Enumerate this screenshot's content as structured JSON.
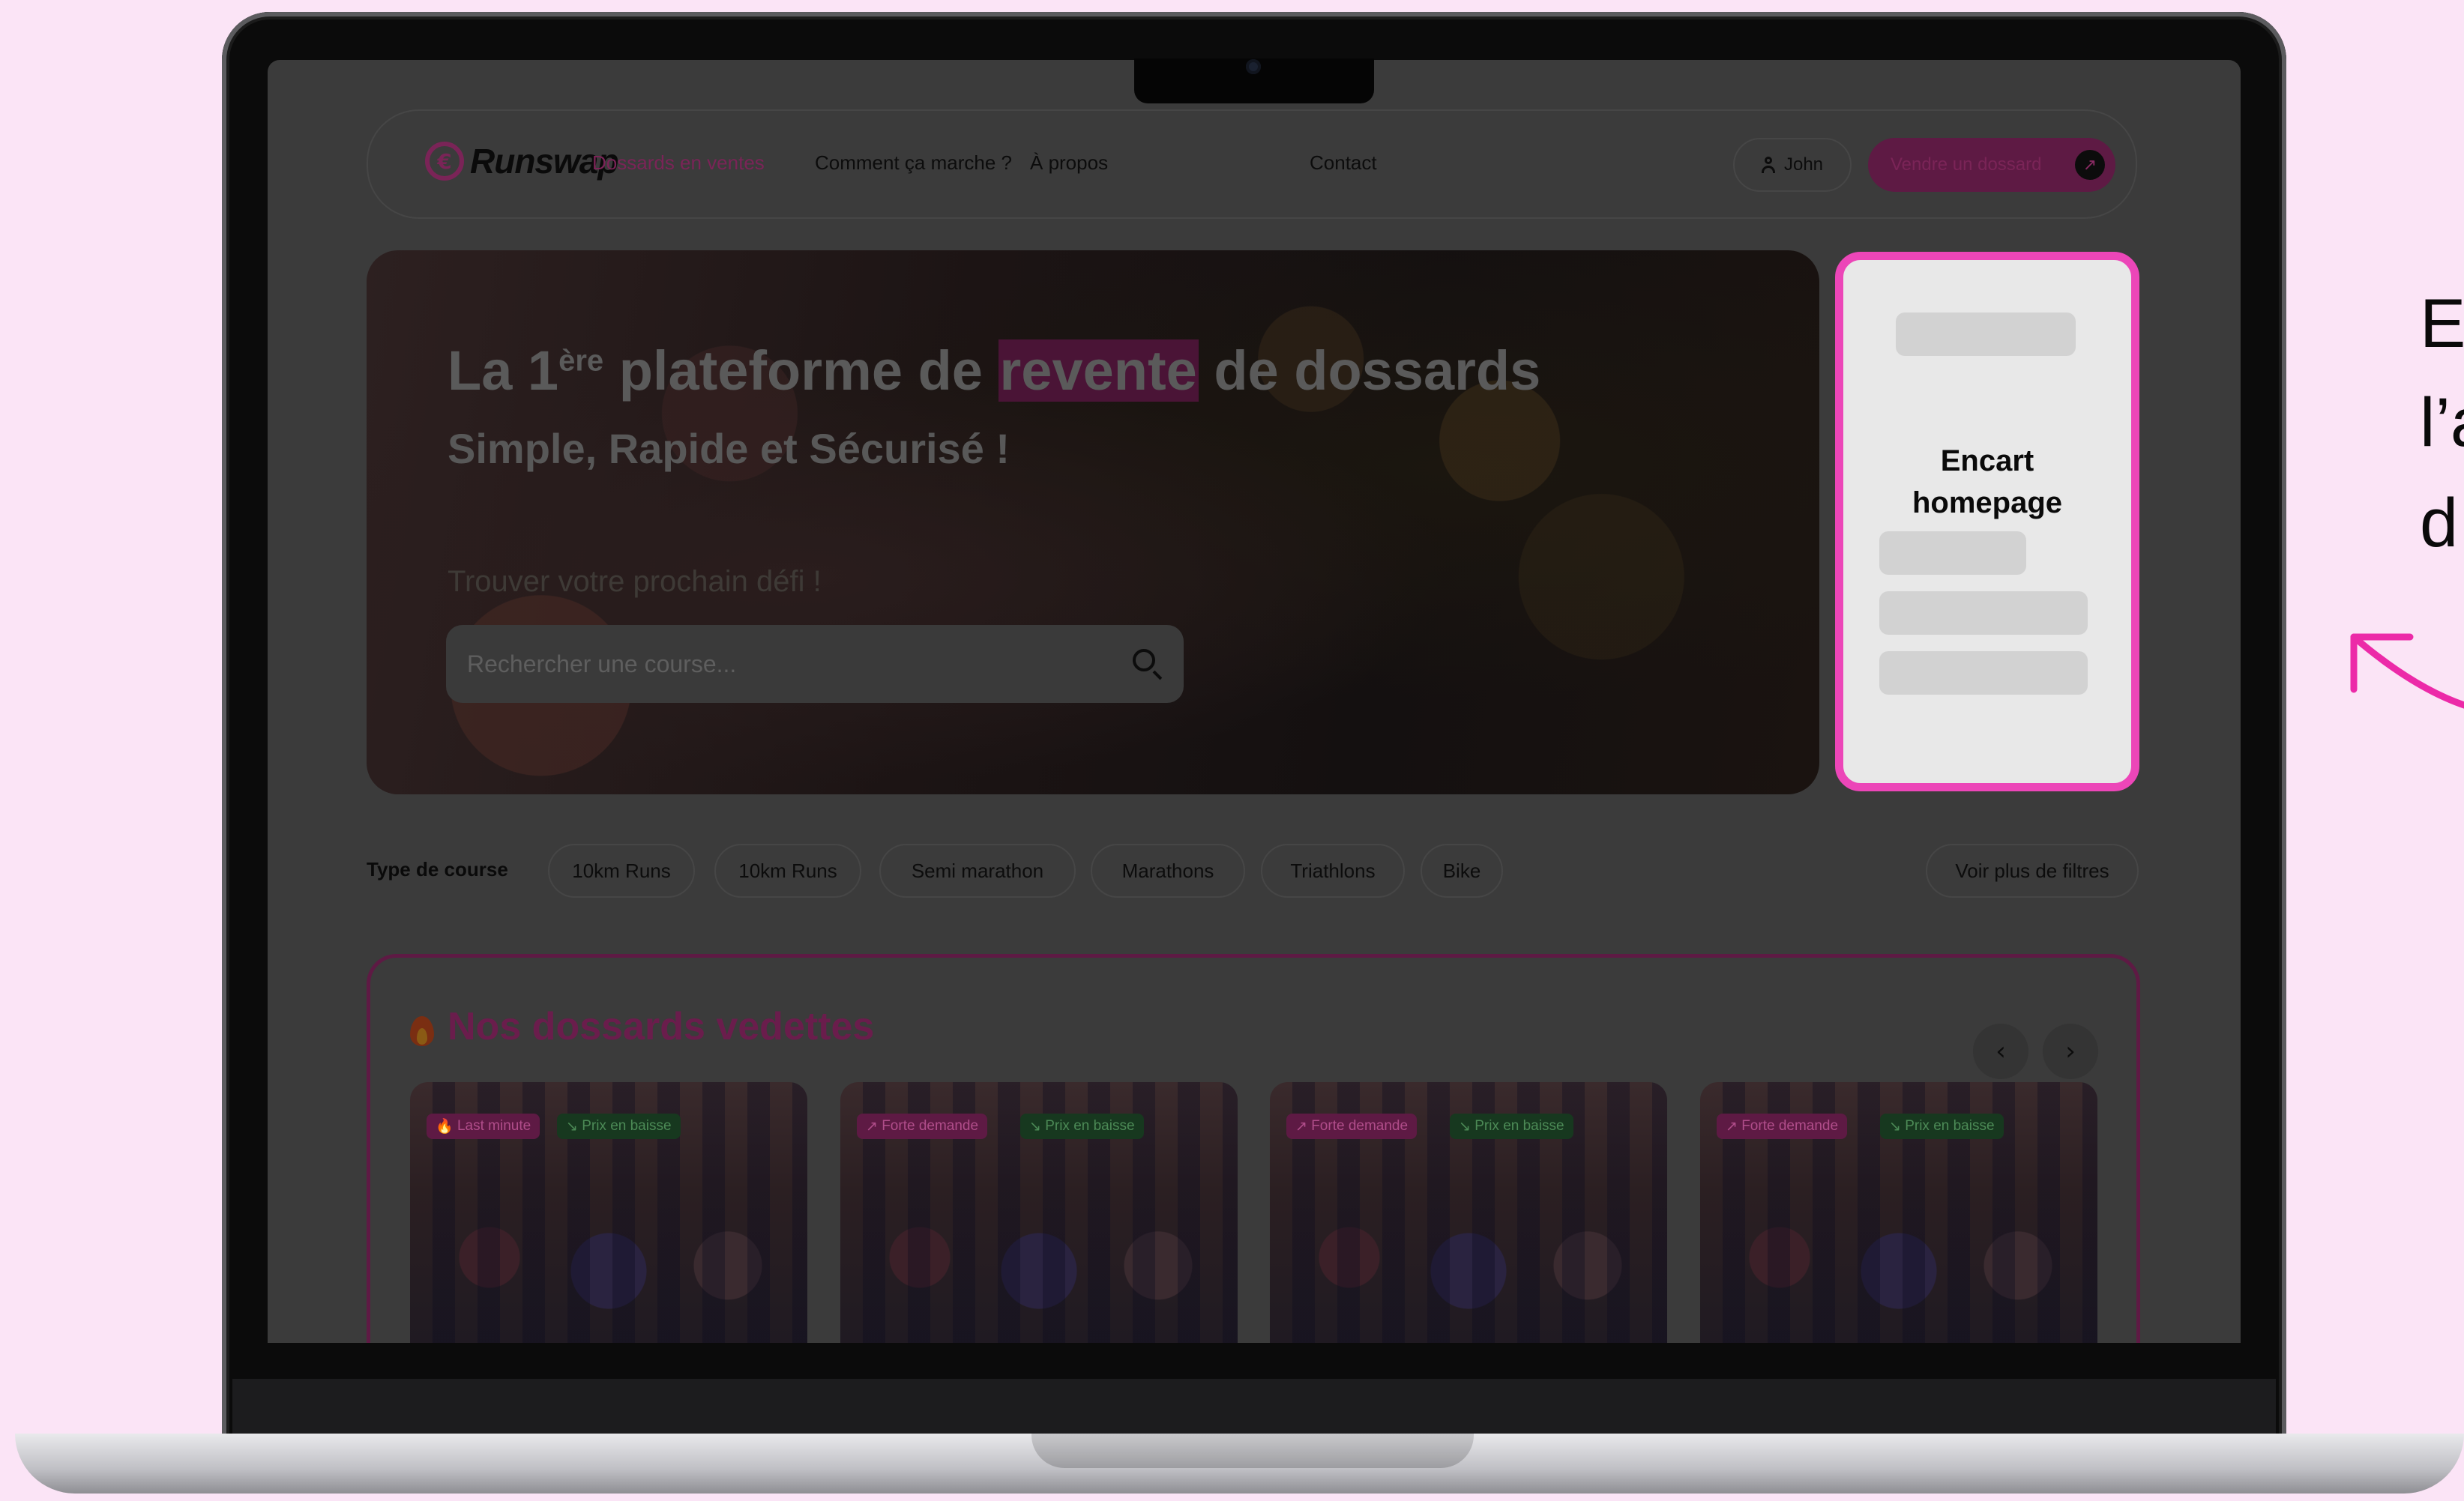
{
  "brand": {
    "name": "Runswap",
    "logo_glyph": "€",
    "accent": "#ec46b8",
    "brand_dark": "#5e1a44"
  },
  "nav": {
    "links": [
      {
        "label": "Dossards en ventes",
        "active": true
      },
      {
        "label": "Comment ça marche ?",
        "active": false
      },
      {
        "label": "À propos",
        "active": false
      },
      {
        "label": "Contact",
        "active": false
      }
    ],
    "user": {
      "name": "John",
      "icon": "user-icon"
    },
    "sell_button": {
      "label": "Vendre un dossard",
      "icon": "arrow-up-right-icon",
      "glyph": "↗"
    }
  },
  "hero": {
    "title_pre": "La 1",
    "title_sup": "ère",
    "title_mid": " plateforme de ",
    "title_highlight": "revente",
    "title_post": " de dossards",
    "subtitle": "Simple, Rapide et Sécurisé !",
    "find_label": "Trouver votre prochain défi !",
    "search": {
      "placeholder": "Rechercher une course...",
      "icon": "search-icon"
    }
  },
  "encart": {
    "label_line1": "Encart",
    "label_line2": "homepage"
  },
  "filters": {
    "label": "Type de course",
    "chips": [
      "10km Runs",
      "10km Runs",
      "Semi marathon",
      "Marathons",
      "Triathlons",
      "Bike"
    ],
    "more": "Voir plus de filtres"
  },
  "featured": {
    "title": "Nos dossards vedettes",
    "icon": "fire-icon",
    "prev_glyph": "‹",
    "next_glyph": "›",
    "cards": [
      {
        "badges": [
          {
            "label": "Last minute",
            "icon": "fire-icon",
            "glyph": "🔥",
            "tone": "pink"
          },
          {
            "label": "Prix en baisse",
            "icon": "arrow-down-right-icon",
            "glyph": "↘",
            "tone": "green"
          }
        ]
      },
      {
        "badges": [
          {
            "label": "Forte demande",
            "icon": "arrow-up-right-icon",
            "glyph": "↗",
            "tone": "pink"
          },
          {
            "label": "Prix en baisse",
            "icon": "arrow-down-right-icon",
            "glyph": "↘",
            "tone": "green"
          }
        ]
      },
      {
        "badges": [
          {
            "label": "Forte demande",
            "icon": "arrow-up-right-icon",
            "glyph": "↗",
            "tone": "pink"
          },
          {
            "label": "Prix en baisse",
            "icon": "arrow-down-right-icon",
            "glyph": "↘",
            "tone": "green"
          }
        ]
      },
      {
        "badges": [
          {
            "label": "Forte demande",
            "icon": "arrow-up-right-icon",
            "glyph": "↗",
            "tone": "pink"
          },
          {
            "label": "Prix en baisse",
            "icon": "arrow-down-right-icon",
            "glyph": "↘",
            "tone": "green"
          }
        ]
      }
    ]
  },
  "annotation": {
    "lines": [
      "E",
      "l’a",
      "d"
    ]
  }
}
